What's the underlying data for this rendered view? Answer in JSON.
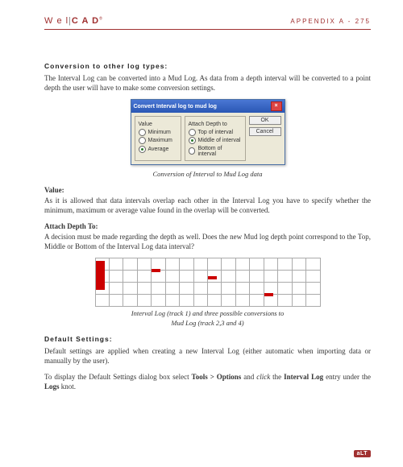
{
  "header": {
    "logo_left": "W e l",
    "logo_right": "C A D",
    "appendix": "APPENDIX A - 275"
  },
  "s1": {
    "title": "Conversion to other log types:",
    "p1": "The Interval Log can be converted into a Mud Log. As data from a depth interval will be converted to a point depth the user will have to make some conversion settings."
  },
  "dlg": {
    "title": "Convert Interval log to mud log",
    "grp1": "Value",
    "grp2": "Attach Depth to",
    "r1": "Minimum",
    "r2": "Maximum",
    "r3": "Average",
    "r4": "Top of interval",
    "r5": "Middle of interval",
    "r6": "Bottom of interval",
    "ok": "OK",
    "cancel": "Cancel"
  },
  "cap1": "Conversion of Interval to Mud Log data",
  "s2": {
    "title": "Value:",
    "p1": "As it is allowed that data intervals overlap each other in the Interval Log you have to specify whether the minimum, maximum or average value found in the overlap will be converted."
  },
  "s3": {
    "title": "Attach Depth To:",
    "p1": "A decision must be made regarding the depth as well. Does the new Mud log depth point correspond to the Top, Middle or Bottom of the Interval Log data interval?"
  },
  "cap2a": "Interval Log (track 1) and three possible conversions to",
  "cap2b": "Mud Log (track 2,3 and 4)",
  "s4": {
    "title": "Default Settings:",
    "p1": "Default settings are applied when creating a new Interval Log (either automatic when importing data or manually by the user).",
    "p2a": "To display the Default Settings dialog box select ",
    "p2b": "Tools > Options",
    "p2c": " and ",
    "p2d": "click",
    "p2e": " the ",
    "p2f": "Interval Log",
    "p2g": " entry under the ",
    "p2h": "Logs",
    "p2i": " knot."
  },
  "footer": "aLT"
}
